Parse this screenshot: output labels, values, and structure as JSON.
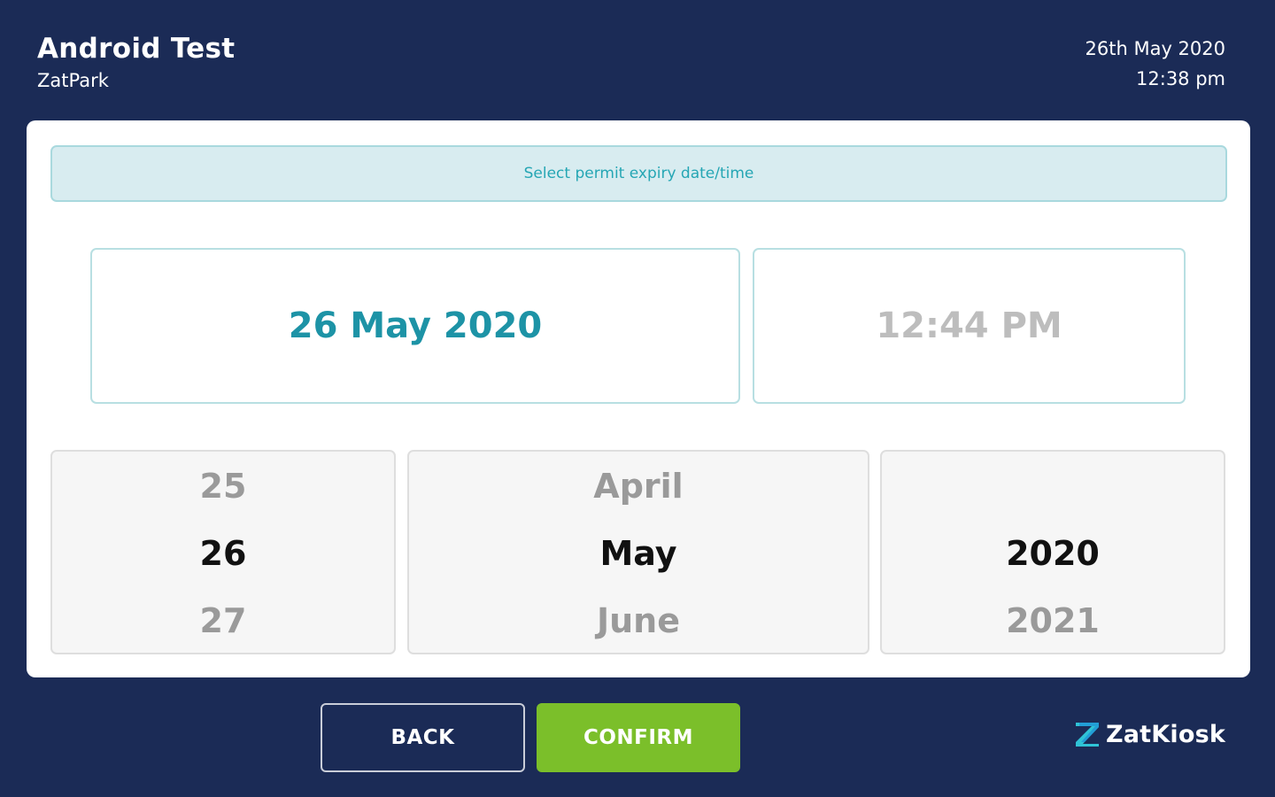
{
  "header": {
    "title": "Android Test",
    "subtitle": "ZatPark",
    "date": "26th May 2020",
    "time": "12:38 pm"
  },
  "main": {
    "instruction": "Select permit expiry date/time",
    "selected_date": "26 May 2020",
    "selected_time": "12:44 PM",
    "day_picker": {
      "prev": "25",
      "current": "26",
      "next": "27"
    },
    "month_picker": {
      "prev": "April",
      "current": "May",
      "next": "June"
    },
    "year_picker": {
      "prev": "",
      "current": "2020",
      "next": "2021"
    }
  },
  "footer": {
    "back_label": "BACK",
    "confirm_label": "CONFIRM",
    "brand_name": "ZatKiosk",
    "brand_icon": "zatkiosk-logo-icon"
  },
  "colors": {
    "background": "#1b2b56",
    "accent": "#1d93a6",
    "confirm": "#7bbf2a"
  }
}
